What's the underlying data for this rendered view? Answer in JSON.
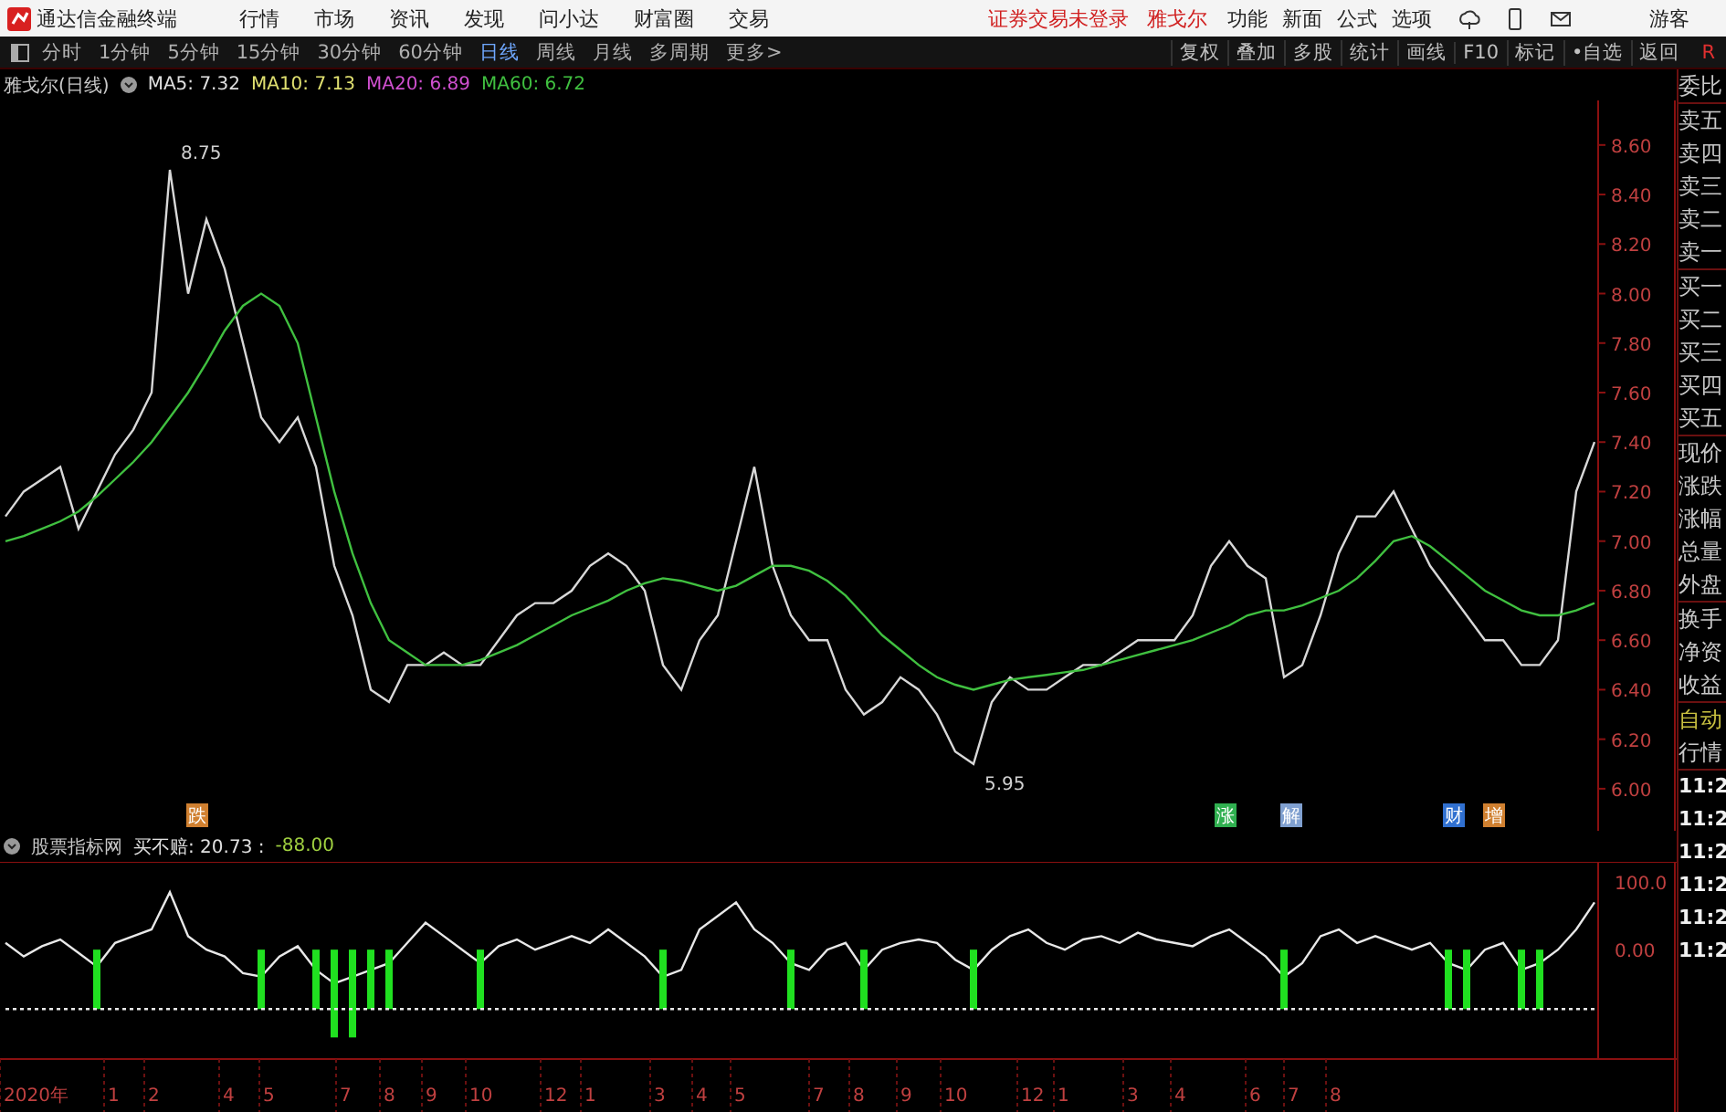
{
  "app_bar": {
    "title": "通达信金融终端",
    "menu": [
      "行情",
      "市场",
      "资讯",
      "发现",
      "问小达",
      "财富圈",
      "交易"
    ],
    "login_status": "证券交易未登录",
    "stock_name": "雅戈尔",
    "tools": [
      "功能",
      "新面",
      "公式",
      "选项"
    ],
    "user": "游客"
  },
  "toolbar": {
    "periods": [
      {
        "label": "分时",
        "selected": false
      },
      {
        "label": "1分钟",
        "selected": false
      },
      {
        "label": "5分钟",
        "selected": false
      },
      {
        "label": "15分钟",
        "selected": false
      },
      {
        "label": "30分钟",
        "selected": false
      },
      {
        "label": "60分钟",
        "selected": false
      },
      {
        "label": "日线",
        "selected": true
      },
      {
        "label": "周线",
        "selected": false
      },
      {
        "label": "月线",
        "selected": false
      },
      {
        "label": "多周期",
        "selected": false
      },
      {
        "label": "更多>",
        "selected": false
      }
    ],
    "actions": [
      "复权",
      "叠加",
      "多股",
      "统计",
      "画线",
      "F10",
      "标记",
      "•自选",
      "返回"
    ],
    "corner": "R"
  },
  "price_panel": {
    "title": "雅戈尔(日线)",
    "legend": [
      {
        "text": "MA5: 7.32",
        "color": "#e0e0e0"
      },
      {
        "text": "MA10: 7.13",
        "color": "#e0e070"
      },
      {
        "text": "MA20: 6.89",
        "color": "#d050d0"
      },
      {
        "text": "MA60: 6.72",
        "color": "#40c040"
      }
    ],
    "events": [
      {
        "text": "跌",
        "color": "#d08030"
      },
      {
        "text": "涨",
        "color": "#30b050"
      },
      {
        "text": "解",
        "color": "#80a0d0"
      },
      {
        "text": "财",
        "color": "#3070d0"
      },
      {
        "text": "增",
        "color": "#d08030"
      }
    ],
    "chart_data": {
      "type": "line",
      "ylim": [
        5.83,
        8.78
      ],
      "yticks": [
        {
          "value": 6.0,
          "label": "6.00"
        },
        {
          "value": 6.2,
          "label": "6.20"
        },
        {
          "value": 6.4,
          "label": "6.40"
        },
        {
          "value": 6.6,
          "label": "6.60"
        },
        {
          "value": 6.8,
          "label": "6.80"
        },
        {
          "value": 7.0,
          "label": "7.00"
        },
        {
          "value": 7.2,
          "label": "7.20"
        },
        {
          "value": 7.4,
          "label": "7.40"
        },
        {
          "value": 7.6,
          "label": "7.60"
        },
        {
          "value": 7.8,
          "label": "7.80"
        },
        {
          "value": 8.0,
          "label": "8.00"
        },
        {
          "value": 8.2,
          "label": "8.20"
        },
        {
          "value": 8.4,
          "label": "8.40"
        },
        {
          "value": 8.6,
          "label": "8.60"
        }
      ],
      "series": [
        {
          "color": "#d8d8d8",
          "values": [
            7.1,
            7.2,
            7.25,
            7.3,
            7.05,
            7.2,
            7.35,
            7.45,
            7.6,
            8.5,
            8.0,
            8.3,
            8.1,
            7.8,
            7.5,
            7.4,
            7.5,
            7.3,
            6.9,
            6.7,
            6.4,
            6.35,
            6.5,
            6.5,
            6.55,
            6.5,
            6.5,
            6.6,
            6.7,
            6.75,
            6.75,
            6.8,
            6.9,
            6.95,
            6.9,
            6.8,
            6.5,
            6.4,
            6.6,
            6.7,
            7.0,
            7.3,
            6.9,
            6.7,
            6.6,
            6.6,
            6.4,
            6.3,
            6.35,
            6.45,
            6.4,
            6.3,
            6.15,
            6.1,
            6.35,
            6.45,
            6.4,
            6.4,
            6.45,
            6.5,
            6.5,
            6.55,
            6.6,
            6.6,
            6.6,
            6.7,
            6.9,
            7.0,
            6.9,
            6.85,
            6.45,
            6.5,
            6.7,
            6.95,
            7.1,
            7.1,
            7.2,
            7.05,
            6.9,
            6.8,
            6.7,
            6.6,
            6.6,
            6.5,
            6.5,
            6.6,
            7.2,
            7.4
          ]
        },
        {
          "color": "#40c040",
          "values": [
            7.0,
            7.02,
            7.05,
            7.08,
            7.12,
            7.18,
            7.25,
            7.32,
            7.4,
            7.5,
            7.6,
            7.72,
            7.85,
            7.95,
            8.0,
            7.95,
            7.8,
            7.5,
            7.2,
            6.95,
            6.75,
            6.6,
            6.55,
            6.5,
            6.5,
            6.5,
            6.52,
            6.55,
            6.58,
            6.62,
            6.66,
            6.7,
            6.73,
            6.76,
            6.8,
            6.83,
            6.85,
            6.84,
            6.82,
            6.8,
            6.82,
            6.86,
            6.9,
            6.9,
            6.88,
            6.84,
            6.78,
            6.7,
            6.62,
            6.56,
            6.5,
            6.45,
            6.42,
            6.4,
            6.42,
            6.44,
            6.45,
            6.46,
            6.47,
            6.48,
            6.5,
            6.52,
            6.54,
            6.56,
            6.58,
            6.6,
            6.63,
            6.66,
            6.7,
            6.72,
            6.72,
            6.74,
            6.77,
            6.8,
            6.85,
            6.92,
            7.0,
            7.02,
            6.98,
            6.92,
            6.86,
            6.8,
            6.76,
            6.72,
            6.7,
            6.7,
            6.72,
            6.75
          ]
        }
      ],
      "annotations": [
        "8.75",
        "5.95"
      ]
    }
  },
  "indicator_panel": {
    "title": "股票指标网",
    "legend": [
      {
        "text": "买不赔: 20.73 :",
        "color": "#e0e0e0"
      },
      {
        "text": "-88.00",
        "color": "#a0d040"
      }
    ],
    "chart_data": {
      "type": "line",
      "ylim": [
        -162,
        130
      ],
      "yticks": [
        {
          "value": 0,
          "label": "0.00"
        },
        {
          "value": 100,
          "label": "100.0"
        }
      ],
      "series": [
        {
          "color": "#e8e8e8",
          "values": [
            10,
            -10,
            5,
            15,
            -5,
            -25,
            10,
            20,
            30,
            85,
            20,
            0,
            -10,
            -35,
            -40,
            -10,
            5,
            -30,
            -50,
            -40,
            -30,
            -20,
            10,
            40,
            20,
            0,
            -20,
            5,
            15,
            0,
            10,
            20,
            10,
            30,
            10,
            -10,
            -40,
            -30,
            30,
            50,
            70,
            30,
            10,
            -20,
            -30,
            0,
            10,
            -30,
            0,
            10,
            15,
            10,
            -15,
            -30,
            0,
            20,
            30,
            10,
            0,
            15,
            20,
            10,
            25,
            15,
            10,
            5,
            20,
            30,
            10,
            -10,
            -40,
            -20,
            20,
            30,
            10,
            20,
            10,
            0,
            10,
            -20,
            -30,
            0,
            10,
            -30,
            -20,
            0,
            30,
            70
          ]
        },
        {
          "color": "#20e020",
          "type": "bar",
          "values": [
            null,
            null,
            null,
            null,
            null,
            -88,
            null,
            null,
            null,
            null,
            null,
            null,
            null,
            null,
            -88,
            null,
            null,
            -88,
            -130,
            -130,
            -88,
            -88,
            null,
            null,
            null,
            null,
            -88,
            null,
            null,
            null,
            null,
            null,
            null,
            null,
            null,
            null,
            -88,
            null,
            null,
            null,
            null,
            null,
            null,
            -88,
            null,
            null,
            null,
            -88,
            null,
            null,
            null,
            null,
            null,
            -88,
            null,
            null,
            null,
            null,
            null,
            null,
            null,
            null,
            null,
            null,
            null,
            null,
            null,
            null,
            null,
            null,
            -88,
            null,
            null,
            null,
            null,
            null,
            null,
            null,
            null,
            -88,
            -88,
            null,
            null,
            -88,
            -88,
            null,
            null,
            null
          ]
        },
        {
          "color": "#e8e8e8",
          "line_style": "dashed",
          "values": [
            -88,
            -88,
            -88,
            -88,
            -88,
            -88,
            -88,
            -88,
            -88,
            -88,
            -88,
            -88,
            -88,
            -88,
            -88,
            -88,
            -88,
            -88,
            -88,
            -88,
            -88,
            -88,
            -88,
            -88,
            -88,
            -88,
            -88,
            -88,
            -88,
            -88,
            -88,
            -88,
            -88,
            -88,
            -88,
            -88,
            -88,
            -88,
            -88,
            -88,
            -88,
            -88,
            -88,
            -88,
            -88,
            -88,
            -88,
            -88,
            -88,
            -88,
            -88,
            -88,
            -88,
            -88,
            -88,
            -88,
            -88,
            -88,
            -88,
            -88,
            -88,
            -88,
            -88,
            -88,
            -88,
            -88,
            -88,
            -88,
            -88,
            -88,
            -88,
            -88,
            -88,
            -88,
            -88,
            -88,
            -88,
            -88,
            -88,
            -88,
            -88,
            -88,
            -88,
            -88,
            -88,
            -88,
            -88,
            -88
          ]
        }
      ]
    },
    "date_axis": [
      "2020年",
      "1",
      "2",
      "4",
      "5",
      "7",
      "8",
      "9",
      "10",
      "12",
      "1",
      "3",
      "4",
      "5",
      "7",
      "8",
      "9",
      "10",
      "12",
      "1",
      "3",
      "4",
      "6",
      "7",
      "8"
    ]
  },
  "quote_panel": {
    "groups": [
      [
        "委比"
      ],
      [
        "卖五",
        "卖四",
        "卖三",
        "卖二",
        "卖一"
      ],
      [
        "买一",
        "买二",
        "买三",
        "买四",
        "买五"
      ],
      [
        "现价",
        "涨跌",
        "涨幅",
        "总量",
        "外盘"
      ],
      [
        "换手",
        "净资",
        "收益"
      ]
    ],
    "tabs": [
      {
        "label": "自动",
        "selected": true
      },
      {
        "label": "行情",
        "selected": false
      }
    ],
    "times": [
      "11:2",
      "11:2",
      "11:2",
      "11:2",
      "11:2",
      "11:2"
    ]
  }
}
